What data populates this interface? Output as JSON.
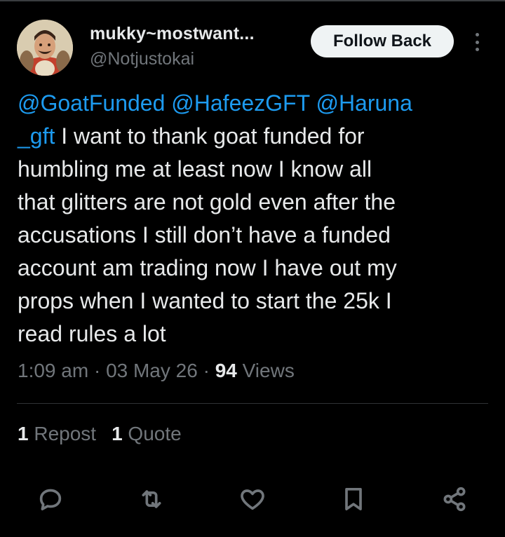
{
  "author": {
    "display_name": "mukky~mostwant...",
    "handle": "@Notjustokai",
    "avatar_icon": "avatar-illustration"
  },
  "follow_button": {
    "label": "Follow Back"
  },
  "more_icon": "more-vertical-icon",
  "tweet": {
    "lines": [
      [
        {
          "text": "@GoatFunded",
          "type": "mention"
        },
        {
          "text": " ",
          "type": "text"
        },
        {
          "text": "@HafeezGFT",
          "type": "mention"
        },
        {
          "text": " ",
          "type": "text"
        },
        {
          "text": "@Haruna",
          "type": "mention"
        }
      ],
      [
        {
          "text": "_gft",
          "type": "mention"
        },
        {
          "text": " I want to thank goat funded for",
          "type": "text"
        }
      ],
      [
        {
          "text": "humbling me at least now I know all",
          "type": "text"
        }
      ],
      [
        {
          "text": "that glitters are not gold even after the",
          "type": "text"
        }
      ],
      [
        {
          "text": "accusations I still don’t have a funded",
          "type": "text"
        }
      ],
      [
        {
          "text": "account am trading now I have out my",
          "type": "text"
        }
      ],
      [
        {
          "text": "props when I wanted to start the 25k I",
          "type": "text"
        }
      ],
      [
        {
          "text": "read rules a lot",
          "type": "text"
        }
      ]
    ]
  },
  "meta": {
    "time": "1:09 am",
    "separator": " · ",
    "date": "03 May 26",
    "views_count": "94",
    "views_label": " Views"
  },
  "stats": {
    "reposts_count": "1",
    "reposts_label": " Repost",
    "quotes_count": "1",
    "quotes_label": " Quote"
  },
  "actions": [
    {
      "name": "reply-button",
      "icon": "reply-icon"
    },
    {
      "name": "repost-button",
      "icon": "repost-icon"
    },
    {
      "name": "like-button",
      "icon": "heart-icon"
    },
    {
      "name": "bookmark-button",
      "icon": "bookmark-icon"
    },
    {
      "name": "share-button",
      "icon": "share-icon"
    }
  ],
  "colors": {
    "background": "#000000",
    "text": "#e7e9ea",
    "secondary": "#71767b",
    "mention": "#1d9bf0",
    "divider": "#2f3336"
  }
}
